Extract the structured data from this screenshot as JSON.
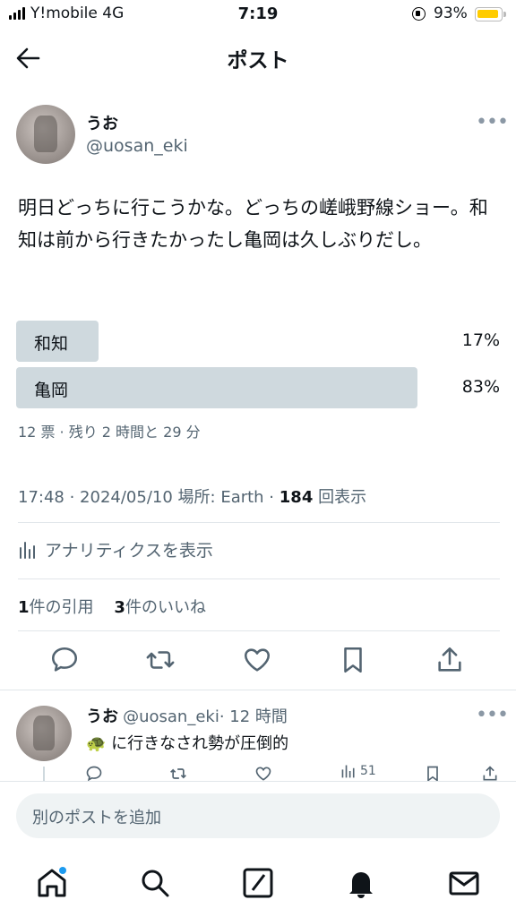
{
  "status_bar": {
    "carrier": "Y!mobile   4G",
    "time": "7:19",
    "battery": "93%"
  },
  "header": {
    "title": "ポスト"
  },
  "post": {
    "author_name": "うお",
    "author_handle": "@uosan_eki",
    "text": "明日どっちに行こうかな。どっちの嵯峨野線ショー。和知は前から行きたかったし亀岡は久しぶりだし。",
    "poll": {
      "options": [
        {
          "label": "和知",
          "percent_text": "17%",
          "percent": 17
        },
        {
          "label": "亀岡",
          "percent_text": "83%",
          "percent": 83
        }
      ],
      "meta": "12 票 · 残り 2 時間と 29 分"
    },
    "timestamp": "17:48 · 2024/05/10",
    "location": "場所: Earth · ",
    "views_count": "184",
    "views_label": " 回表示",
    "analytics_label": "アナリティクスを表示",
    "quotes_count": "1",
    "quotes_label": "件の引用",
    "likes_count": "3",
    "likes_label": "件のいいね"
  },
  "reply": {
    "author_name": "うお",
    "author_handle": "@uosan_eki",
    "time": "· 12 時間",
    "emoji": "🐢",
    "text": "に行きなされ勢が圧倒的",
    "views": "51"
  },
  "compose": {
    "placeholder": "別のポストを追加"
  },
  "colors": {
    "accent": "#1d9bf0",
    "poll_bar": "#cfd9de",
    "secondary_text": "#536471",
    "battery": "#ffcc00"
  }
}
